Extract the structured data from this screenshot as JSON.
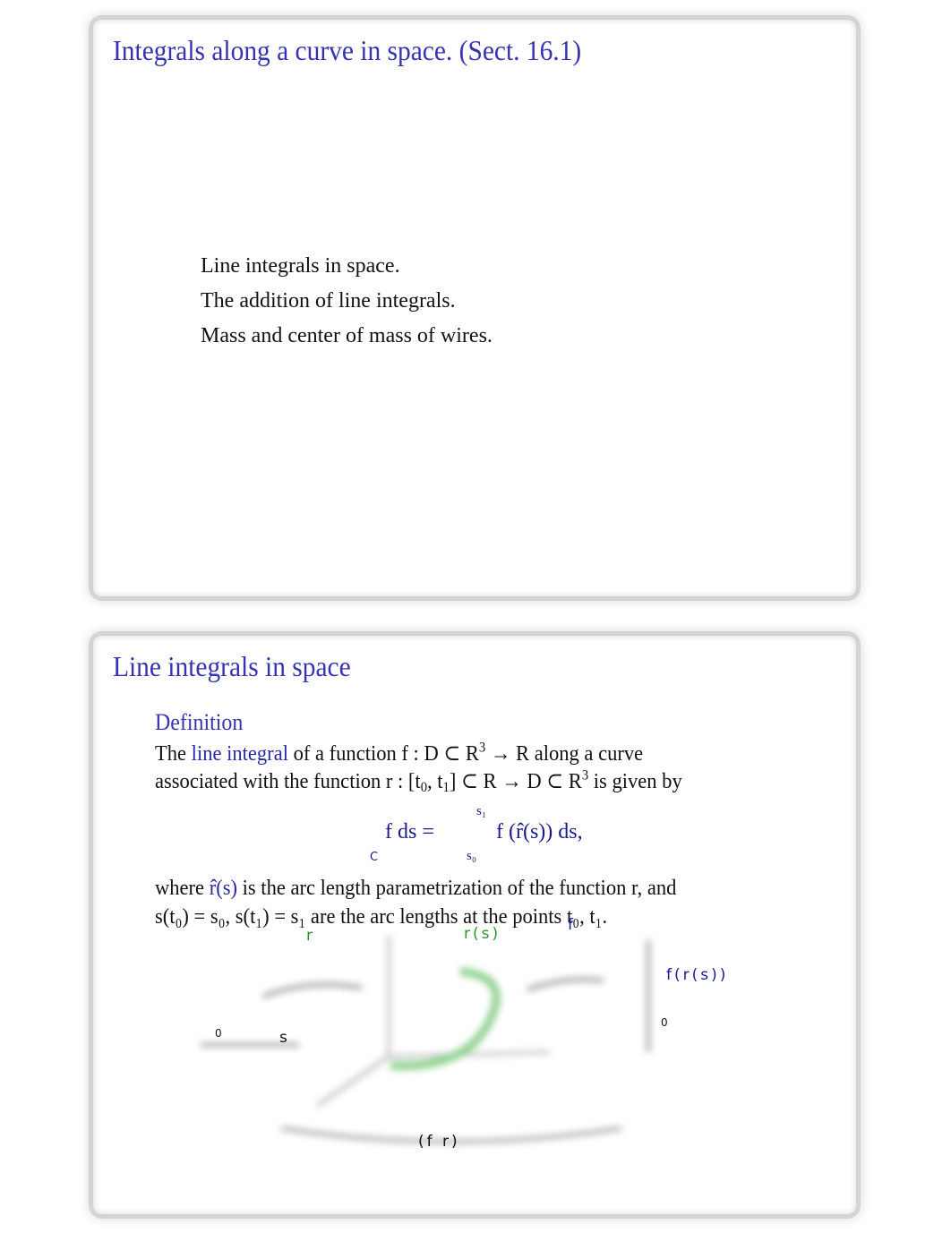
{
  "slides": [
    {
      "title": "Integrals along a curve in space. (Sect. 16.1)",
      "outline": [
        "Line integrals in space.",
        "The addition of line integrals.",
        "Mass and center of mass of wires."
      ]
    },
    {
      "title": "Line integrals in space",
      "definition": {
        "heading": "Definition",
        "line1": {
          "pre": "The ",
          "term": "line integral",
          "post": " of a function  f : D ⊂ R",
          "sup": "3",
          "tail": " → R along a curve"
        },
        "line2": {
          "pre": "associated with the function  r : [t",
          "sub0": "0",
          "mid": ", t",
          "sub1": "1",
          "post": "] ⊂ R → D ⊂ R",
          "sup": "3",
          "tail": " is given by"
        },
        "formula": {
          "lhs": "f  ds =",
          "domain": "C",
          "upper": "s₁",
          "lower": "s₀",
          "rhs": "f (r̂(s)) ds,"
        },
        "line3": {
          "pre": "where ",
          "rhat": "r̂(s)",
          "post": " is the arc length parametrization of the function   r, and"
        },
        "line4": "s(t₀) =  s₀, s(t₁) =  s₁ are the arc lengths at the points   t₀, t₁."
      },
      "diagram": {
        "labels": {
          "r": "r",
          "rs": "r(s)",
          "f": "f",
          "frs": "f(r(s))",
          "zero_left": "0",
          "s": "s",
          "zero_right": "0",
          "composition": "(f  r)"
        },
        "colors": {
          "curve": "#8fd08f",
          "green_label": "#229922",
          "blue_label": "#1a1a9a"
        }
      }
    }
  ]
}
